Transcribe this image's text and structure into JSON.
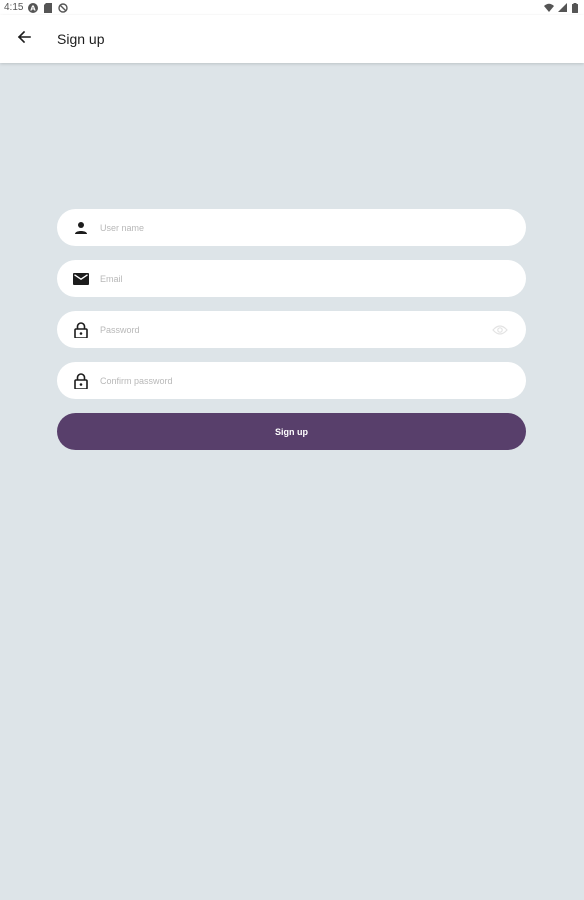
{
  "status_bar": {
    "time": "4:15",
    "left_icons": [
      "accessibility-icon",
      "sd-card-icon",
      "blocked-icon"
    ],
    "right_icons": [
      "wifi-icon",
      "signal-icon",
      "battery-icon"
    ]
  },
  "app_bar": {
    "title": "Sign up",
    "back_icon": "arrow-back-icon"
  },
  "form": {
    "username": {
      "placeholder": "User name",
      "icon": "person-icon"
    },
    "email": {
      "placeholder": "Email",
      "icon": "mail-icon"
    },
    "password": {
      "placeholder": "Password",
      "icon": "lock-icon",
      "toggle_icon": "eye-icon"
    },
    "confirm_password": {
      "placeholder": "Confirm password",
      "icon": "lock-icon"
    },
    "submit_label": "Sign up"
  },
  "colors": {
    "background": "#dde4e8",
    "primary": "#583f6b",
    "surface": "#ffffff"
  }
}
